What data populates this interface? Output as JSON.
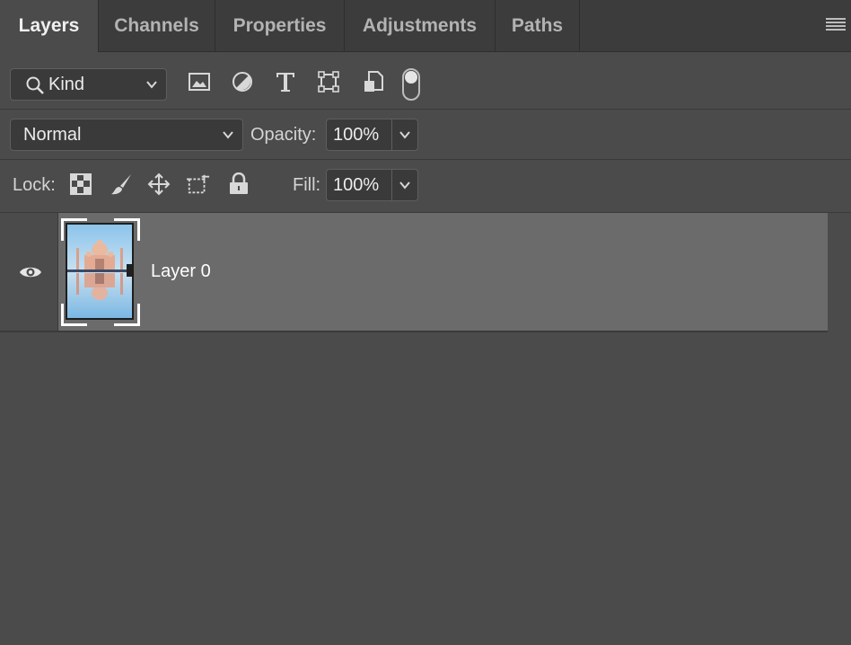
{
  "tabs": [
    {
      "label": "Layers",
      "active": true
    },
    {
      "label": "Channels",
      "active": false
    },
    {
      "label": "Properties",
      "active": false
    },
    {
      "label": "Adjustments",
      "active": false
    },
    {
      "label": "Paths",
      "active": false
    }
  ],
  "filter": {
    "kind_label": "Kind",
    "icons": [
      "image-filter-icon",
      "adjustment-filter-icon",
      "type-filter-icon",
      "shape-filter-icon",
      "smart-object-filter-icon"
    ],
    "toggle_on": false
  },
  "blend": {
    "mode": "Normal",
    "opacity_label": "Opacity:",
    "opacity_value": "100%"
  },
  "lock": {
    "label": "Lock:",
    "icons": [
      "lock-transparent-icon",
      "lock-paint-icon",
      "lock-position-icon",
      "lock-artboard-icon",
      "lock-all-icon"
    ],
    "fill_label": "Fill:",
    "fill_value": "100%"
  },
  "layers": [
    {
      "name": "Layer 0",
      "visible": true,
      "selected": true
    }
  ],
  "colors": {
    "panel_bg": "#4b4b4b",
    "tabbar_bg": "#3c3c3c",
    "selected_layer_bg": "#6b6b6b"
  }
}
